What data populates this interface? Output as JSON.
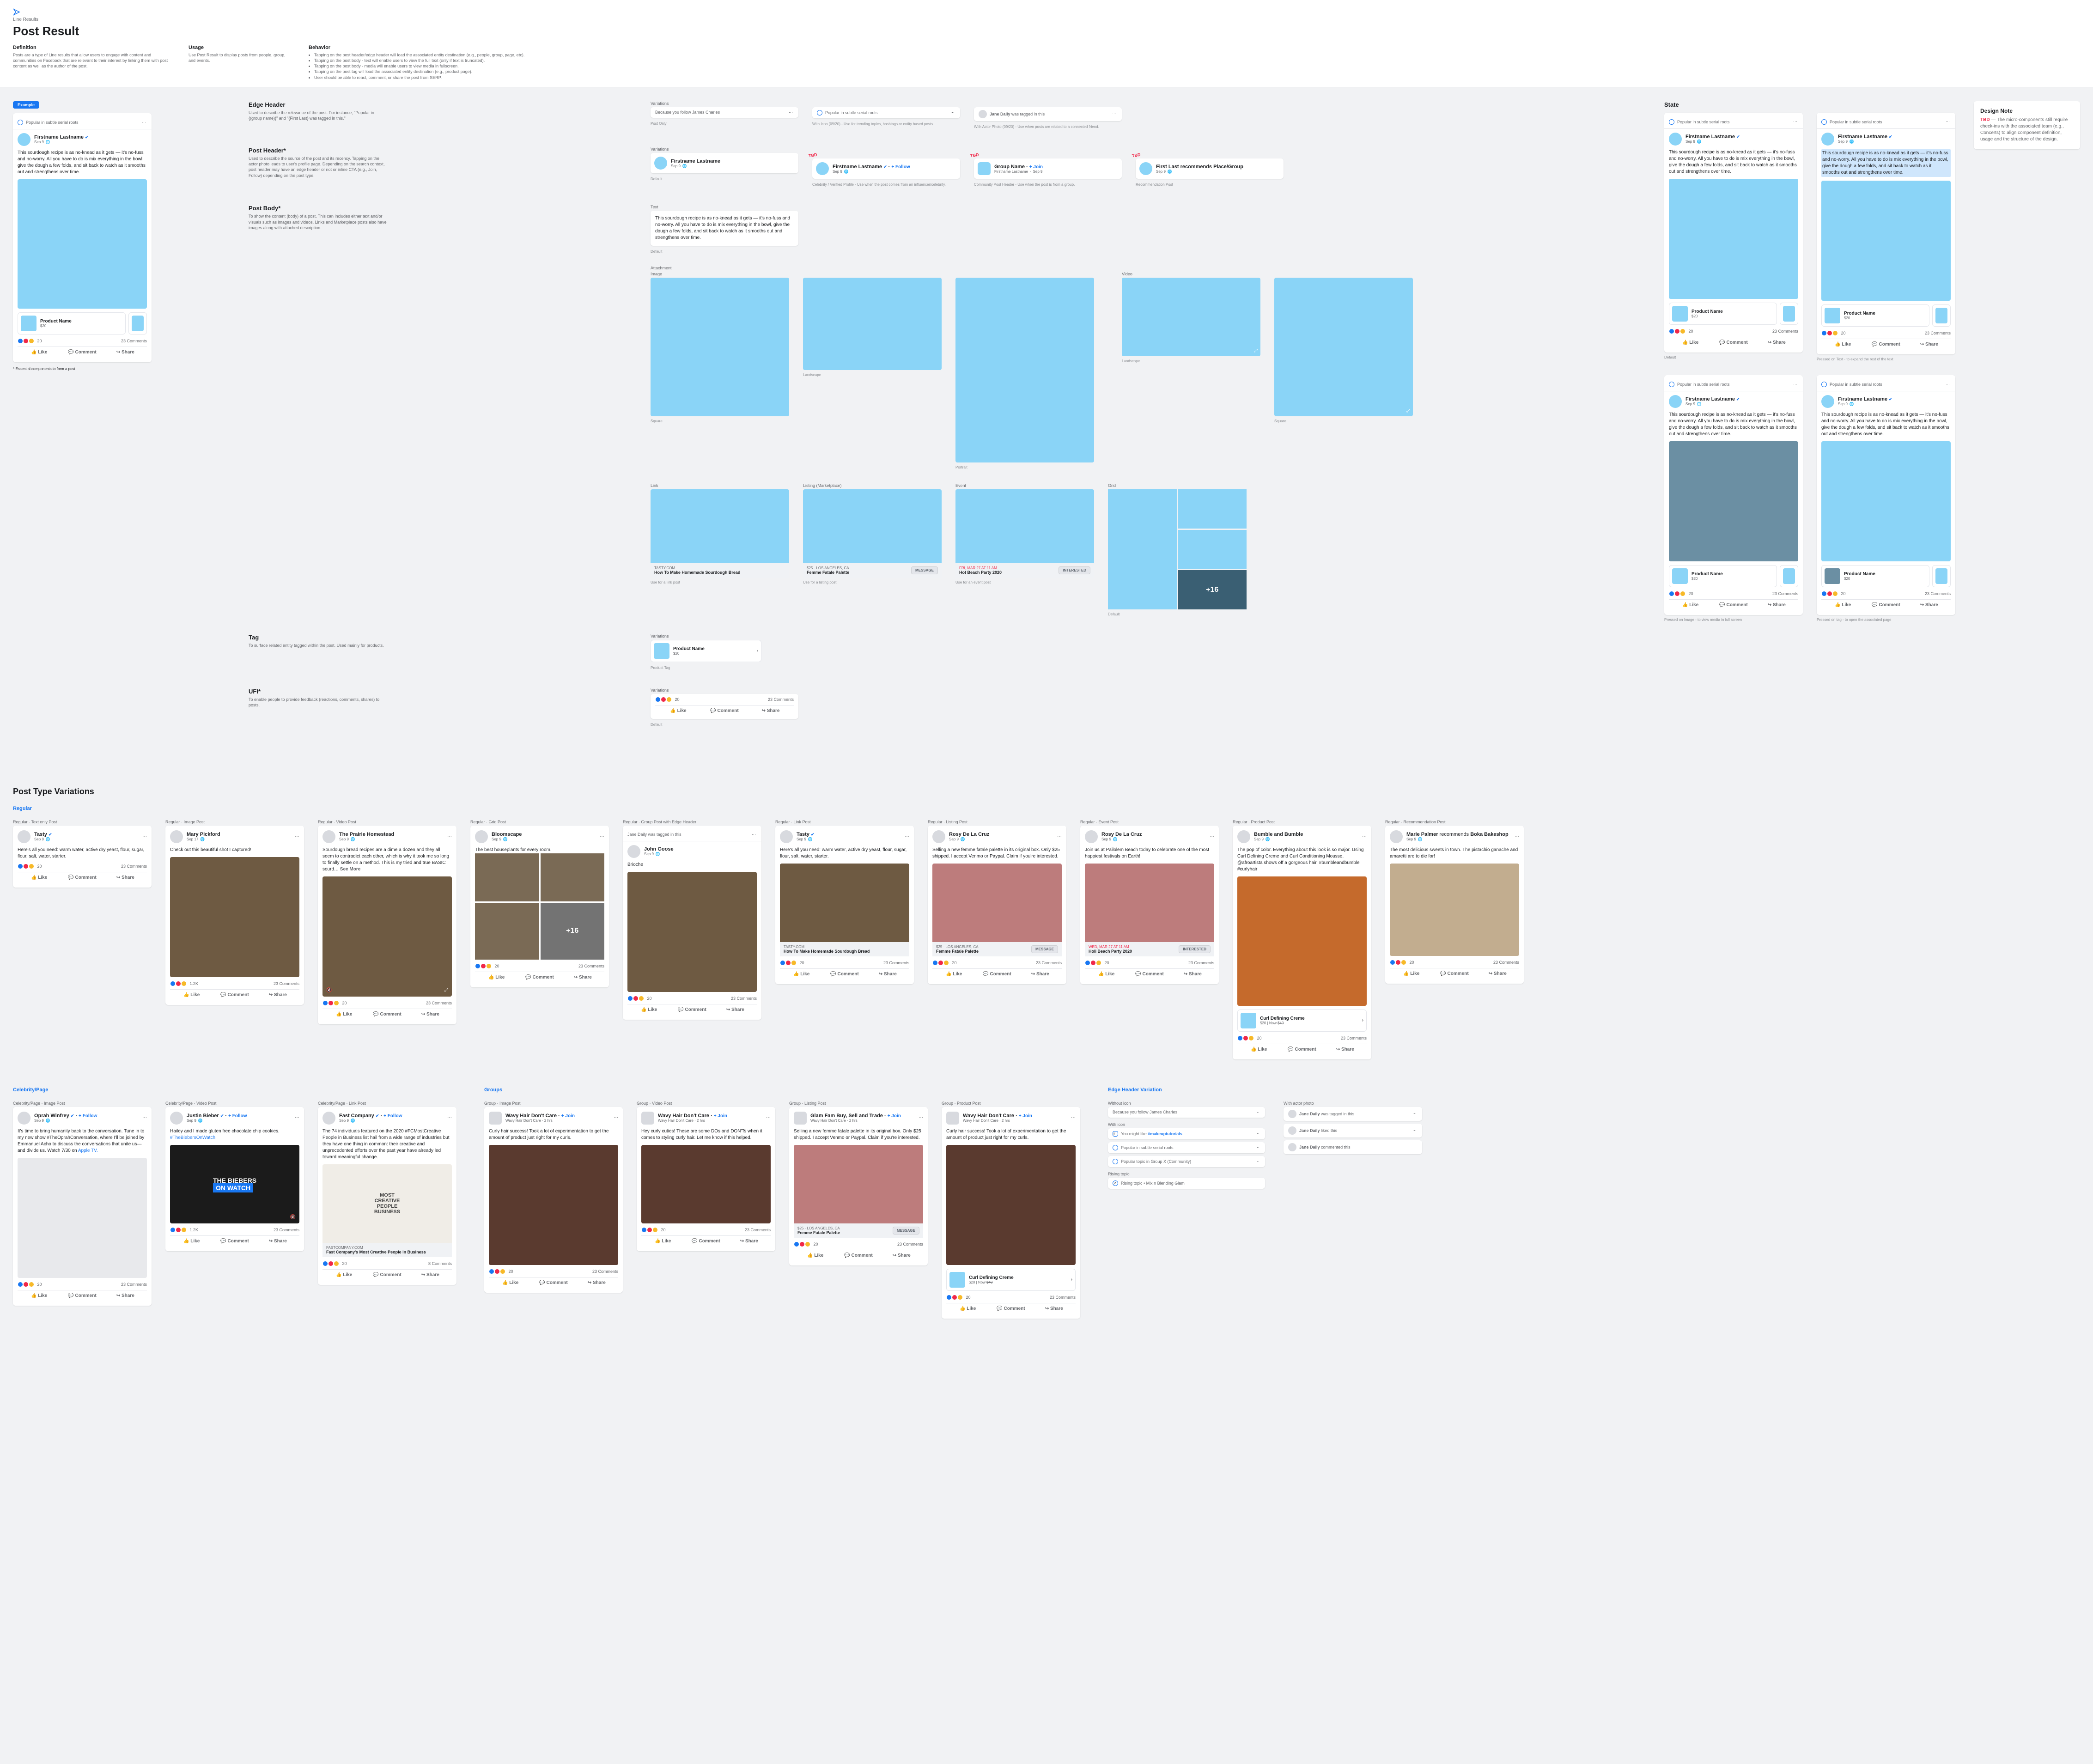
{
  "breadcrumb": "Line Results",
  "title": "Post Result",
  "definition_h": "Definition",
  "definition": "Posts are a type of Line results that allow users to engage with content and communities on Facebook that are relevant to their interest by linking them with post content as well as the author of the post.",
  "usage_h": "Usage",
  "usage": "Use Post Result to display posts from people, group, and events.",
  "behavior_h": "Behavior",
  "behavior": [
    "Tapping on the post header/edge header will load the associated entity destination (e.g., people, group, page, etc).",
    "Tapping on the post body - text will enable users to view the full text (only if text is truncated).",
    "Tapping on the post body - media will enable users to view media in fullscreen.",
    "Tapping on the post tag will load the associated entity destination (e.g., product page).",
    "User should be able to react, comment, or share the post from SERP."
  ],
  "example_chip": "Example",
  "example_edge": "Popular in subtle serial roots",
  "example_name": "Firstname Lastname",
  "example_date": "Sep 9",
  "example_body": "This sourdough recipe is as no-knead as it gets — it's no-fuss and no-worry. All you have to do is mix everything in the bowl, give the dough a few folds, and sit back to watch as it smooths out and strengthens over time.",
  "product_name": "Product Name",
  "product_price": "$20",
  "react_count": "20",
  "comments_txt": "23 Comments",
  "like_txt": "Like",
  "comment_txt": "Comment",
  "share_txt": "Share",
  "essential_note": "* Essential components to form a post",
  "edge_header_h": "Edge Header",
  "edge_header_d": "Used to describe the relevance of the post. For instance, \"Popular in {(group name)}\" and \"{First Last} was tagged in this.\"",
  "variations_h": "Variations",
  "edge_v1": "Because you follow James Charles",
  "edge_v1_sub": "Post Only",
  "edge_v2": "Popular in subtle serial roots",
  "edge_v2_sub": "With Icon (09/20) - Use for trending topics, hashtags or entity based posts.",
  "edge_v3_name": "Jane Daily",
  "edge_v3_txt": "was tagged in this",
  "edge_v3_sub": "With Actor Photo (09/20) - Use when posts are related to a connected friend.",
  "post_header_h": "Post Header*",
  "post_header_d": "Used to describe the source of the post and its recency. Tapping on the actor photo leads to user's profile page. Depending on the search context, post header may have an edge header or not or inline CTA (e.g., Join, Follow) depending on the post type.",
  "ph_v1_sub": "Default",
  "ph_v2_sub": "Celebrity / Verified Profile - Use when the post comes from an influencer/celebrity.",
  "group_name": "Group Name",
  "ph_v3_sub": "Community Post Header - Use when the post is from a group.",
  "first_last": "First Last",
  "recs": "recommends",
  "place_group": "Place/Group",
  "ph_v4_sub": "Recommendation Post",
  "follow_txt": "+ Follow",
  "join_txt": "+ Join",
  "tbd_txt": "TBD",
  "post_body_h": "Post Body*",
  "post_body_d": "To show the content (body) of a post. This can includes either text and/or visuals such as images and videos. Links and Marketplace posts also have images along with attached description.",
  "text_h": "Text",
  "pb_default": "Default",
  "attachment_h": "Attachment",
  "image_h": "Image",
  "video_h": "Video",
  "att_landscape": "Landscape",
  "att_square": "Square",
  "att_portrait": "Portrait",
  "link_h": "Link",
  "link_host": "TASTY.COM",
  "link_title": "How To Make Homemade Sourdough Bread",
  "link_sub": "Use for a link post",
  "listing_h": "Listing (Marketplace)",
  "listing_loc": "$25 · LOS ANGELES, CA",
  "listing_ttl": "Femme Fatale Palette",
  "message_btn": "MESSAGE",
  "listing_sub": "Use for a listing post",
  "event_h": "Event",
  "event_time": "FRI, MAR 27 AT 11 AM",
  "event_ttl": "Hot Beach Party 2020",
  "interested_btn": "INTERESTED",
  "event_sub": "Use for an event post",
  "grid_h": "Grid",
  "grid_more": "+16",
  "grid_sub": "Default",
  "tag_h": "Tag",
  "tag_d": "To surface related entity tagged within the post. Used mainly for products.",
  "tag_sub": "Product Tag",
  "ufi_h": "UFI*",
  "ufi_d": "To enable people to provide feedback (reactions, comments, shares) to posts.",
  "state_h": "State",
  "state_default": "Default",
  "state_text_pressed": "Pressed on Text - to expand the rest of the text",
  "state_img_pressed": "Pressed on Image - to view media in full screen",
  "state_tag_pressed": "Pressed on tag - to open the associated page",
  "dn_h": "Design Note",
  "dn_p": " — The micro-components still require check-ins with the associated team (e.g., Concerts) to align component definition, usage and the structure of the design.",
  "ptv_h": "Post Type Variations",
  "regular_h": "Regular",
  "r_text_lbl": "Regular · Text only Post",
  "r_video_lbl": "Regular · Video Post",
  "r_image_lbl": "Regular · Image Post",
  "r_grid_lbl": "Regular · Grid Post",
  "r_group_image_lbl": "Regular · Group Post with Edge Header",
  "r_link_lbl": "Regular · Link Post",
  "r_listing_lbl": "Regular · Listing Post",
  "r_event_lbl": "Regular · Event Post",
  "r_product_lbl": "Regular · Product Post",
  "r_rec_lbl": "Regular · Recommendation Post",
  "celeb_h": "Celebrity/Page",
  "groups_h": "Groups",
  "ehv_h": "Edge Header Variation",
  "tasty_name": "Tasty",
  "sep9": "Sep 9",
  "sep17": "Sep 17",
  "tasty_text": "Here's all you need: warm water, active dry yeast, flour, sugar, flour, salt, water, starter.",
  "mary_name": "Mary Pickford",
  "mary_text": "Check out this beautiful shot I captured!",
  "prairie_name": "The Prairie Homestead",
  "prairie_text": "Sourdough bread recipes are a dime a dozen and they all seem to contradict each other, which is why it took me so long to finally settle on a method. This is my tried and true BASIC sourd… ",
  "see_more": "See More",
  "bloom_name": "Bloomscape",
  "bloom_text": "The best houseplants for every room.",
  "react_12k": "1.2K",
  "johng_name": "John Goose",
  "johng_text": "Brioche",
  "rosy_name": "Rosy De La Cruz",
  "rosy_list_text": "Selling a new femme fatale palette in its original box. Only $25 shipped. I accept Venmo or Paypal. Claim if you're interested.",
  "rosy_event_text": "Join us at Pailolem Beach today to celebrate one of the most happiest festivals on Earth!",
  "holi_time": "WED, MAR 27 AT 11 AM",
  "holi_ttl": "Holi Beach Party 2020",
  "bumble_name": "Bumble and Bumble",
  "bumble_text": "The pop of color. Everything about this look is so major. Using Curl Defining Creme and Curl Conditioning Mousse. @afroartista shows off a gorgeous hair. #bumbleandbumble #curlyhair",
  "curl_prod": "Curl Defining Creme",
  "prod_now": "$20 | Now",
  "prod_slash": "$40",
  "marie_name": "Marie Palmer",
  "boka_name": "Boka Bakeshop",
  "marie_text": "The most delicious sweets in town. The pistachio ganache and amaretti are to die for!",
  "oprah_name": "Oprah Winfrey",
  "oprah_text": "It's time to bring humanity back to the conversation.  Tune in to my new show #TheOprahConversation, where I'll be joined by Emmanuel Acho to discuss the conversations that unite us—and divide us. Watch 7/30 on ",
  "apple_tv": "Apple TV.",
  "justin_name": "Justin Bieber",
  "justin_text": "Hailey and I made gluten free chocolate chip cookies. ",
  "biebers_hash": "#TheBiebersOnWatch",
  "fc_name": "Fast Company",
  "fc_text": "The 74 individuals featured on the 2020 #FCMostCreative People in Business list hail from a wide range of industries but they have one thing in common: their creative and unprecedented efforts over the past year have already led toward meaningful change.",
  "fc_host": "FASTCOMPANY.COM",
  "fc_link_title": "Fast Company's Most Creative People in Business",
  "wavy_name": "Wavy Hair Don't Care",
  "wavy_ago": "Wavy Hair Don't Care · 2 hrs",
  "wavy_text1": "Curly hair success! Took a lot of experimentation to get the amount of product just right for my curls.",
  "wavy_text2": "Hey curly cuties! These are some DOs and DON'Ts when it comes to styling curly hair. Let me know if this helped.",
  "glam_name": "Glam Fam Buy, Sell and Trade",
  "rec_because": "Because you follow James Charles",
  "rec_might": "You might like ",
  "rec_might_link": "#makeuptutorials",
  "rec_popular_roots": "Popular in subtle serial roots",
  "rec_popular_group": "Popular topic in Group X (Community)",
  "rec_site": "Rising topic",
  "rec_rising": "Rising topic • Mix n Blending Glam",
  "tag_name2": "Jane Daily",
  "tag_in": "was tagged in this",
  "tag_liked": "liked this",
  "tag_commented": "commented this"
}
